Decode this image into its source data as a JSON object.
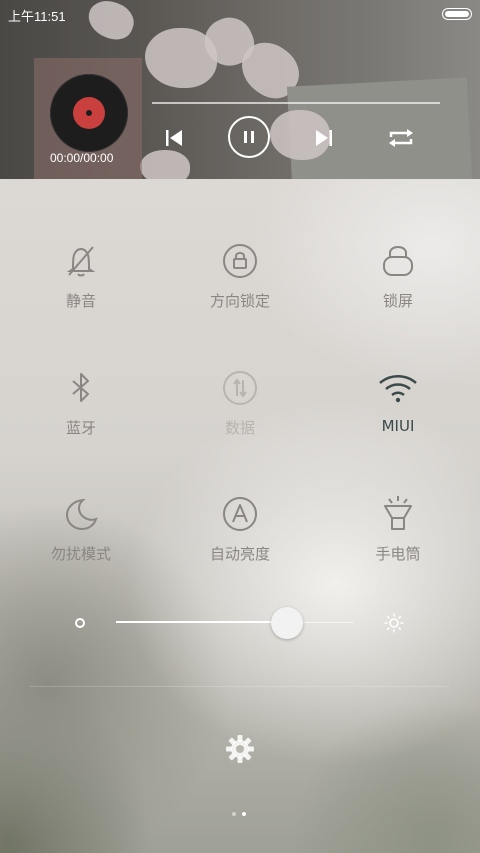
{
  "status_bar": {
    "time": "上午11:51"
  },
  "media": {
    "time_display": "00:00/00:00",
    "progress": 0
  },
  "toggles": [
    {
      "label": "静音",
      "icon": "bell-off-icon",
      "state": "off"
    },
    {
      "label": "方向锁定",
      "icon": "rotation-lock-icon",
      "state": "off"
    },
    {
      "label": "锁屏",
      "icon": "lock-icon",
      "state": "off"
    },
    {
      "label": "蓝牙",
      "icon": "bluetooth-icon",
      "state": "off"
    },
    {
      "label": "数据",
      "icon": "mobile-data-icon",
      "state": "disabled"
    },
    {
      "label": "MIUI",
      "icon": "wifi-icon",
      "state": "on"
    },
    {
      "label": "勿扰模式",
      "icon": "moon-icon",
      "state": "off"
    },
    {
      "label": "自动亮度",
      "icon": "auto-brightness-icon",
      "state": "off"
    },
    {
      "label": "手电筒",
      "icon": "flashlight-icon",
      "state": "off"
    }
  ],
  "brightness": {
    "level": 0.72
  },
  "pager": {
    "pages": 2,
    "current": 1
  },
  "colors": {
    "active_label": "#3b4a4a",
    "inactive_label": "#8a8683",
    "disabled_label": "#b7b4b0"
  }
}
